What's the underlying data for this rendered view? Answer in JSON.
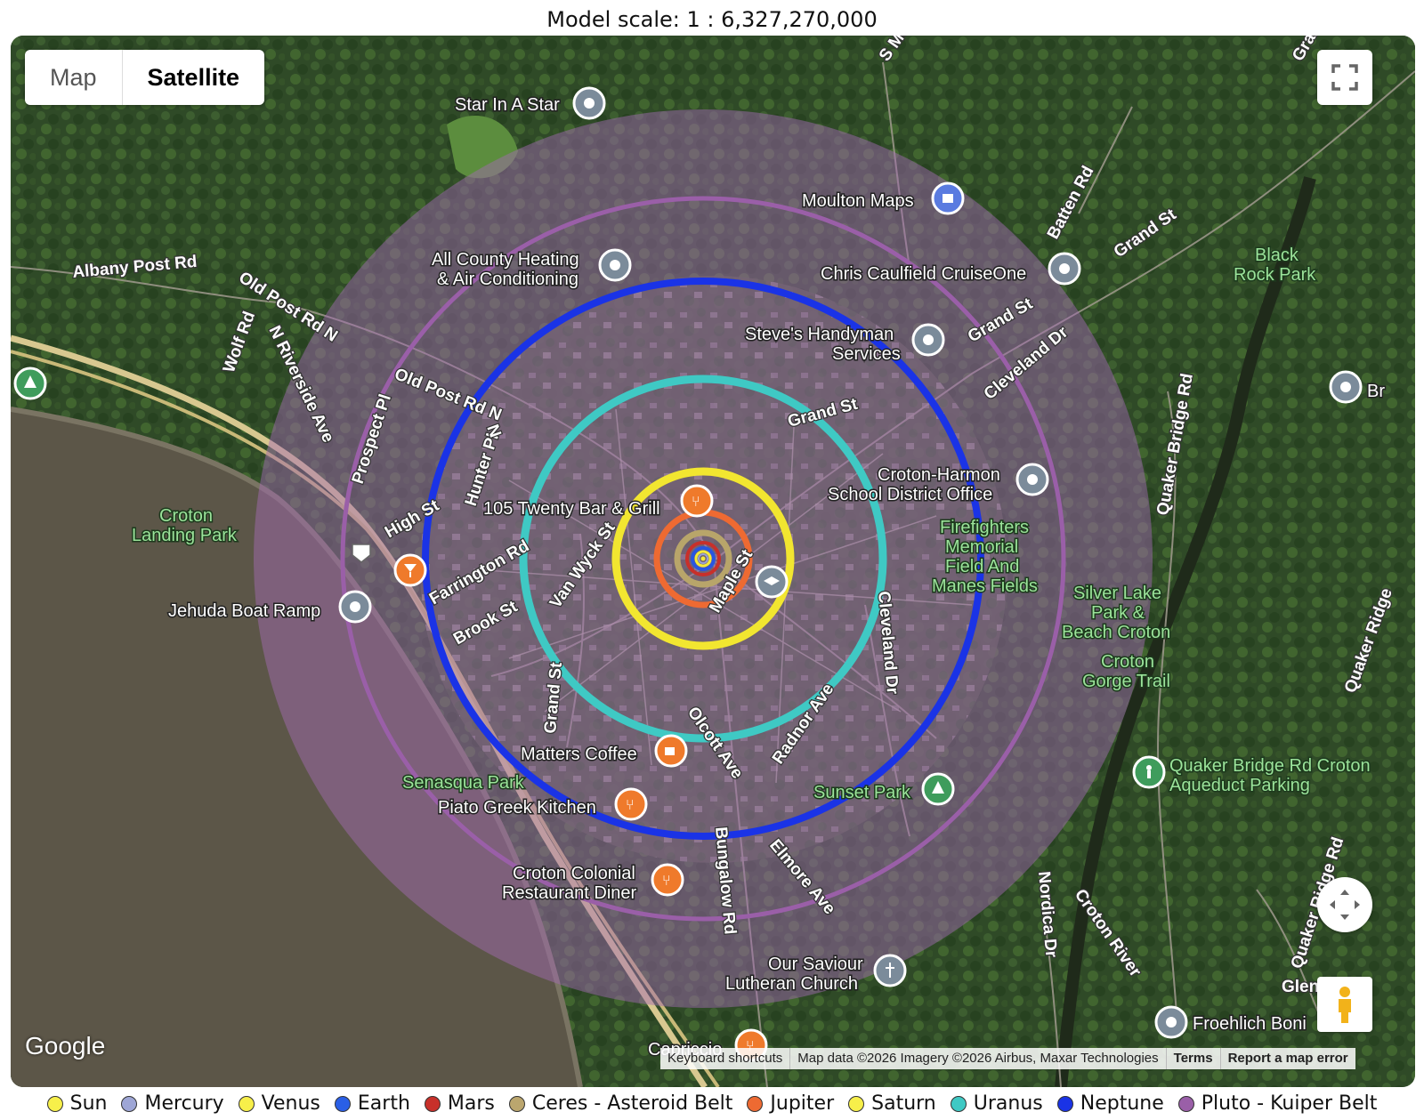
{
  "header": {
    "subtitle": "",
    "scale_text": "Model scale: 1 : 6,327,270,000"
  },
  "map": {
    "type_control": {
      "map_label": "Map",
      "satellite_label": "Satellite",
      "selected": "Satellite"
    },
    "google_logo": "Google",
    "attribution": {
      "keyboard": "Keyboard shortcuts",
      "data": "Map data ©2026 Imagery ©2026 Airbus, Maxar Technologies",
      "terms": "Terms",
      "report": "Report a map error"
    },
    "places": [
      {
        "name": "Star In A Star",
        "icon": "pin-icon"
      },
      {
        "name": "Moulton Maps",
        "icon": "shopping-bag-icon"
      },
      {
        "name": "All County Heating & Air Conditioning",
        "line1": "All County Heating",
        "line2": "& Air Conditioning",
        "icon": "pin-icon"
      },
      {
        "name": "Chris Caulfield CruiseOne",
        "icon": "pin-icon"
      },
      {
        "name": "Steve's Handyman Services",
        "line1": "Steve's Handyman",
        "line2": "Services",
        "icon": "pin-icon"
      },
      {
        "name": "Black Rock Park",
        "line1": "Black",
        "line2": "Rock Park",
        "icon": "park-icon"
      },
      {
        "name": "Croton-Harmon School District Office",
        "line1": "Croton-Harmon",
        "line2": "School District Office",
        "icon": "pin-icon"
      },
      {
        "name": "Firefighters Memorial Field And Manes Fields",
        "line1": "Firefighters",
        "line2": "Memorial",
        "line3": "Field And",
        "line4": "Manes Fields",
        "icon": "park-icon"
      },
      {
        "name": "105 Twenty Bar & Grill",
        "icon": "restaurant-icon"
      },
      {
        "name": "Croton Landing Park",
        "line1": "Croton",
        "line2": "Landing Park",
        "icon": "park-icon"
      },
      {
        "name": "Jehuda Boat Ramp",
        "icon": "pin-icon"
      },
      {
        "name": "Silver Lake Park & Beach Croton",
        "line1": "Silver Lake",
        "line2": "Park &",
        "line3": "Beach Croton",
        "icon": "park-icon"
      },
      {
        "name": "Croton Gorge Trail",
        "line1": "Croton",
        "line2": "Gorge Trail",
        "icon": "park-icon"
      },
      {
        "name": "Matters Coffee",
        "icon": "coffee-icon"
      },
      {
        "name": "Senasqua Park",
        "icon": "park-icon"
      },
      {
        "name": "Piato Greek Kitchen",
        "icon": "restaurant-icon"
      },
      {
        "name": "Sunset Park",
        "icon": "tree-icon"
      },
      {
        "name": "Quaker Bridge Rd Croton Aqueduct Parking",
        "line1": "Quaker Bridge Rd Croton",
        "line2": "Aqueduct Parking",
        "icon": "hiking-icon"
      },
      {
        "name": "Croton Colonial Restaurant Diner",
        "line1": "Croton Colonial",
        "line2": "Restaurant Diner",
        "icon": "restaurant-icon"
      },
      {
        "name": "Our Saviour Lutheran Church",
        "line1": "Our Saviour",
        "line2": "Lutheran Church",
        "icon": "church-icon"
      },
      {
        "name": "Froehlich Boni",
        "icon": "pin-icon"
      },
      {
        "name": "Capriccio",
        "icon": "restaurant-icon"
      },
      {
        "name": "Br",
        "icon": "pin-icon"
      }
    ],
    "roads": [
      "Albany Post Rd",
      "Old Post Rd N",
      "Old Post Rd N",
      "Wolf Rd",
      "N Riverside Ave",
      "Prospect Pl",
      "Hunter Pl",
      "High St",
      "Farrington Rd",
      "Brook St",
      "Van Wyck St",
      "Grand St",
      "Grand St",
      "Grand St",
      "Cleveland Dr",
      "Batten Rd",
      "S Mountain",
      "Maple St",
      "Olcott Ave",
      "Radnor Ave",
      "Bungalow Rd",
      "Elmore Ave",
      "Nordica Dr",
      "Croton River",
      "Quaker Bridge Rd",
      "Quaker Ridge Rd",
      "Glendale",
      "Quaker Ridge",
      "Grand St",
      "Grand St",
      "N",
      "Cleveland Dr"
    ],
    "orbits": [
      {
        "body": "Pluto - Kuiper Belt",
        "color": "#9a5fa8",
        "kind": "band"
      },
      {
        "body": "Pluto - Kuiper Belt",
        "color": "#9a5fa8",
        "kind": "ring"
      },
      {
        "body": "Neptune",
        "color": "#1a33e6",
        "kind": "ring"
      },
      {
        "body": "Uranus",
        "color": "#3fc9c4",
        "kind": "ring"
      },
      {
        "body": "Saturn",
        "color": "#f2e630",
        "kind": "ring"
      },
      {
        "body": "Jupiter",
        "color": "#ee6a32",
        "kind": "ring"
      },
      {
        "body": "Ceres - Asteroid Belt",
        "color": "#b8a56a",
        "kind": "ring"
      },
      {
        "body": "Mars",
        "color": "#c8302a",
        "kind": "ring"
      },
      {
        "body": "Earth",
        "color": "#2856e0",
        "kind": "ring"
      },
      {
        "body": "Venus",
        "color": "#f4ea3a",
        "kind": "ring"
      },
      {
        "body": "Mercury",
        "color": "#9aa3d6",
        "kind": "ring"
      },
      {
        "body": "Sun",
        "color": "#f4ea3a",
        "kind": "dot"
      }
    ]
  },
  "legend": [
    {
      "label": "Sun",
      "color": "#f7ef4a"
    },
    {
      "label": "Mercury",
      "color": "#9ea6d6"
    },
    {
      "label": "Venus",
      "color": "#f7ef4a"
    },
    {
      "label": "Earth",
      "color": "#2a5fe6"
    },
    {
      "label": "Mars",
      "color": "#c8302a"
    },
    {
      "label": "Ceres - Asteroid Belt",
      "color": "#bba66e"
    },
    {
      "label": "Jupiter",
      "color": "#ee6a32"
    },
    {
      "label": "Saturn",
      "color": "#f7ef4a"
    },
    {
      "label": "Uranus",
      "color": "#3fc9c4"
    },
    {
      "label": "Neptune",
      "color": "#1a33e6"
    },
    {
      "label": "Pluto - Kuiper Belt",
      "color": "#9a5fa8"
    }
  ]
}
